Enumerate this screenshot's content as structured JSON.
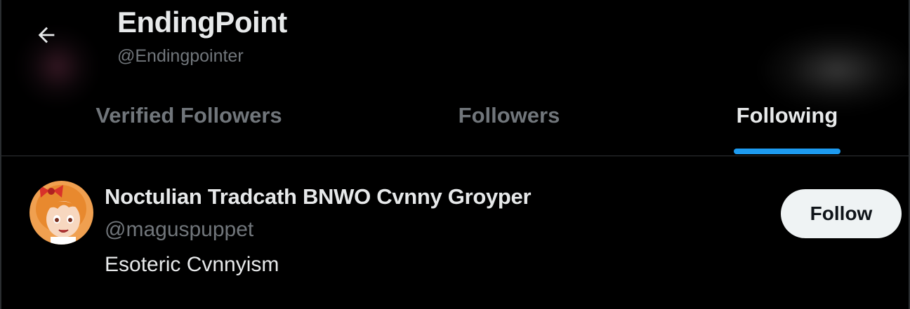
{
  "header": {
    "back_icon": "arrow-left-icon",
    "name": "EndingPoint",
    "handle": "@Endingpointer"
  },
  "tabs": [
    {
      "label": "Verified Followers",
      "active": false
    },
    {
      "label": "Followers",
      "active": false
    },
    {
      "label": "Following",
      "active": true
    }
  ],
  "list": [
    {
      "name": "Noctulian Tradcath BNWO Cvnny Groyper",
      "handle": "@maguspuppet",
      "bio": "Esoteric Cvnnyism",
      "follow_label": "Follow"
    }
  ],
  "colors": {
    "background": "#000000",
    "primary_text": "#e7e9ea",
    "secondary_text": "#71767b",
    "accent": "#1d9bf0",
    "follow_button_bg": "#eff3f4"
  }
}
